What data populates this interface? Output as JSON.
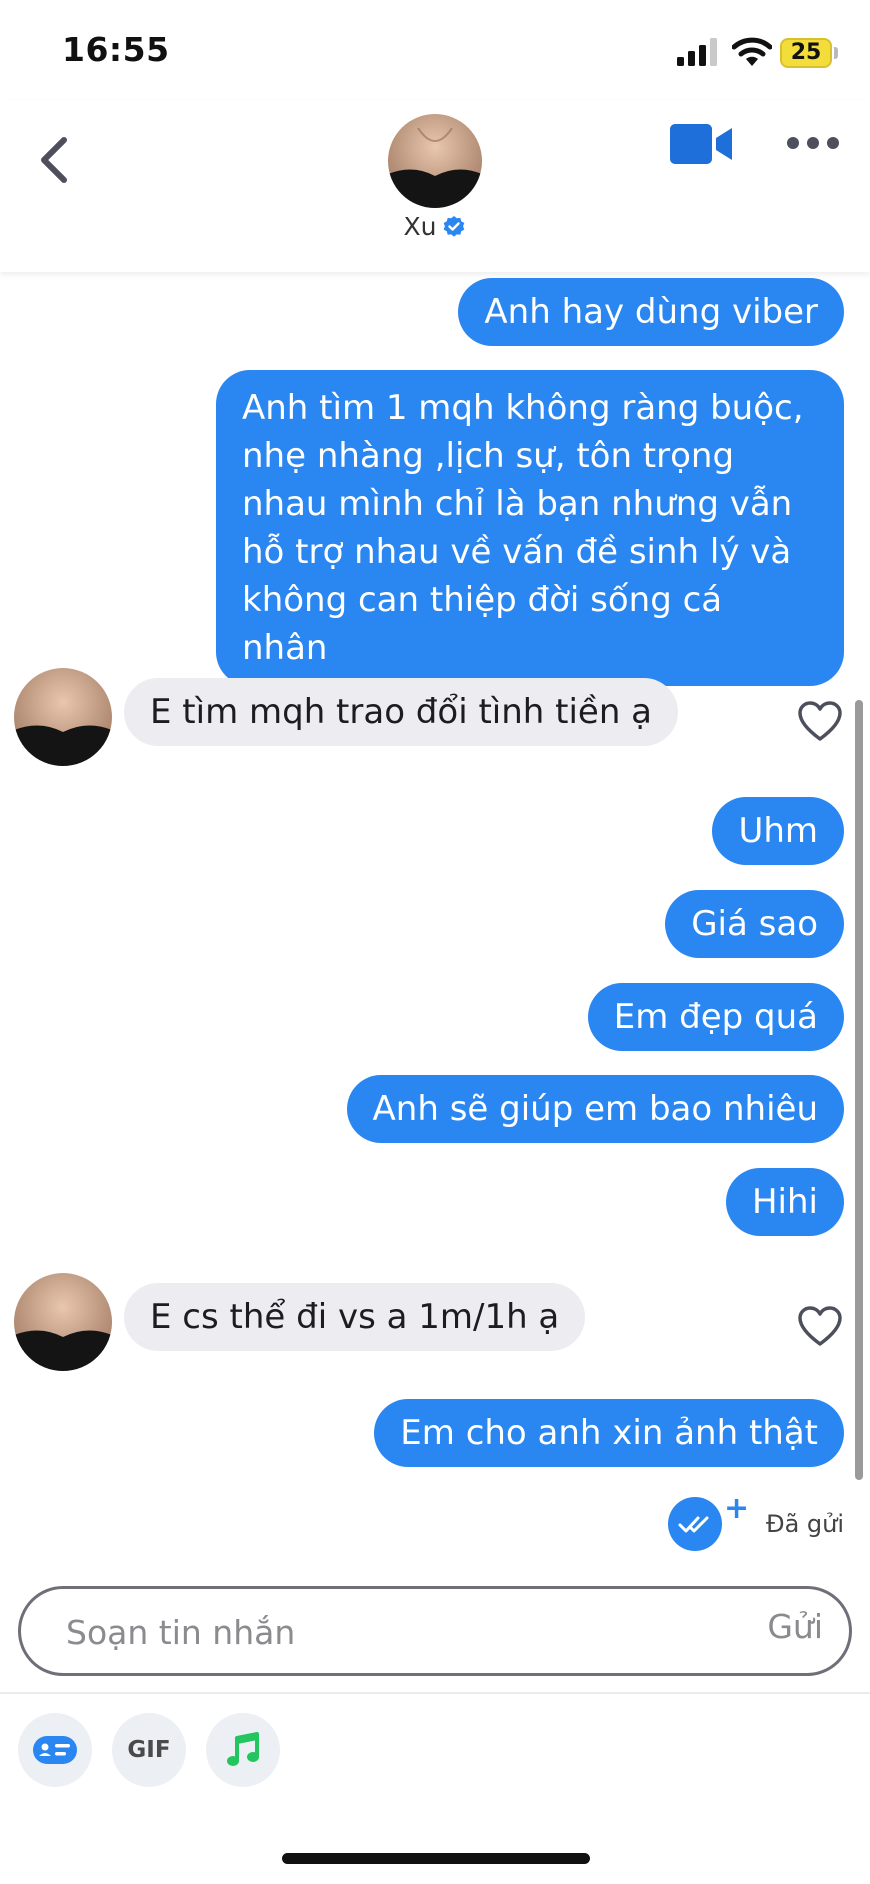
{
  "status_bar": {
    "time": "16:55",
    "battery": "25"
  },
  "header": {
    "contact_name": "Xu"
  },
  "messages": [
    {
      "side": "sent",
      "text": "Anh hay dùng viber"
    },
    {
      "side": "sent",
      "text": "Anh tìm 1 mqh không ràng buộc, nhẹ nhàng ,lịch sự, tôn trọng nhau mình chỉ là bạn nhưng vẫn hỗ trợ nhau về vấn đề sinh lý và không can thiệp đời sống cá nhân"
    },
    {
      "side": "received",
      "text": "E tìm mqh trao đổi tình tiền ạ"
    },
    {
      "side": "sent",
      "text": "Uhm"
    },
    {
      "side": "sent",
      "text": "Giá sao"
    },
    {
      "side": "sent",
      "text": "Em đẹp quá"
    },
    {
      "side": "sent",
      "text": "Anh sẽ giúp em bao nhiêu"
    },
    {
      "side": "sent",
      "text": "Hihi"
    },
    {
      "side": "received",
      "text": "E cs thể đi vs a 1m/1h ạ"
    },
    {
      "side": "sent",
      "text": "Em cho anh xin ảnh thật"
    }
  ],
  "delivery_status": "Đã gửi",
  "composer": {
    "placeholder": "Soạn tin nhắn",
    "send_label": "Gửi"
  },
  "toolbar": {
    "gif_label": "GIF"
  },
  "colors": {
    "sent_bubble": "#2a86f0",
    "received_bubble": "#ececf1",
    "accent": "#2a86f0",
    "music_icon": "#22c55e"
  },
  "icons": [
    "back-arrow-icon",
    "video-camera-icon",
    "more-dots-icon",
    "verified-badge-icon",
    "heart-icon",
    "double-check-icon",
    "sticker-card-icon",
    "music-note-icon"
  ]
}
